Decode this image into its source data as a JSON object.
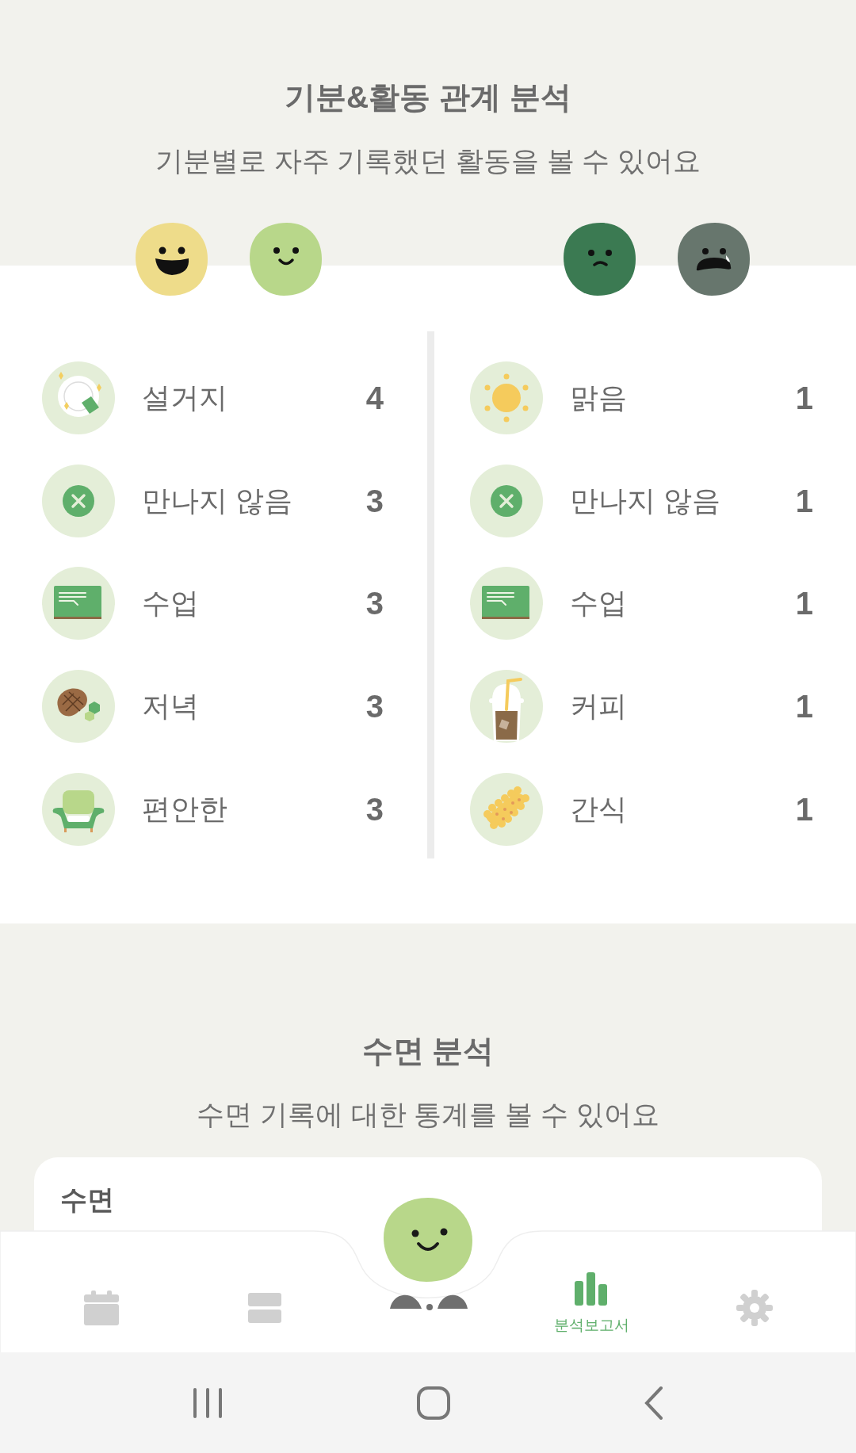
{
  "header": {
    "title": "기분&활동 관계 분석",
    "subtitle": "기분별로 자주 기록했던 활동을 볼 수 있어요"
  },
  "moods": [
    {
      "kind": "laugh",
      "color": "#eedc8a"
    },
    {
      "kind": "smile",
      "color": "#b8d78a"
    },
    {
      "kind": "sad",
      "color": "#3b7a52"
    },
    {
      "kind": "cry",
      "color": "#67766d"
    }
  ],
  "columns": [
    {
      "items": [
        {
          "kind": "dishes",
          "label": "설거지",
          "count": "4"
        },
        {
          "kind": "none",
          "label": "만나지 않음",
          "count": "3"
        },
        {
          "kind": "class",
          "label": "수업",
          "count": "3"
        },
        {
          "kind": "dinner",
          "label": "저녁",
          "count": "3"
        },
        {
          "kind": "sofa",
          "label": "편안한",
          "count": "3"
        }
      ]
    },
    {
      "items": [
        {
          "kind": "sunny",
          "label": "맑음",
          "count": "1"
        },
        {
          "kind": "none",
          "label": "만나지 않음",
          "count": "1"
        },
        {
          "kind": "class",
          "label": "수업",
          "count": "1"
        },
        {
          "kind": "coffee",
          "label": "커피",
          "count": "1"
        },
        {
          "kind": "snack",
          "label": "간식",
          "count": "1"
        }
      ]
    }
  ],
  "sleep": {
    "title": "수면 분석",
    "subtitle": "수면 기록에 대한 통계를 볼 수 있어요",
    "card_title": "수면"
  },
  "nav": {
    "items": [
      {
        "kind": "calendar",
        "selected": false
      },
      {
        "kind": "list",
        "selected": false
      },
      {
        "kind": "report",
        "label": "분석보고서",
        "selected": true
      },
      {
        "kind": "settings",
        "selected": false
      }
    ]
  }
}
